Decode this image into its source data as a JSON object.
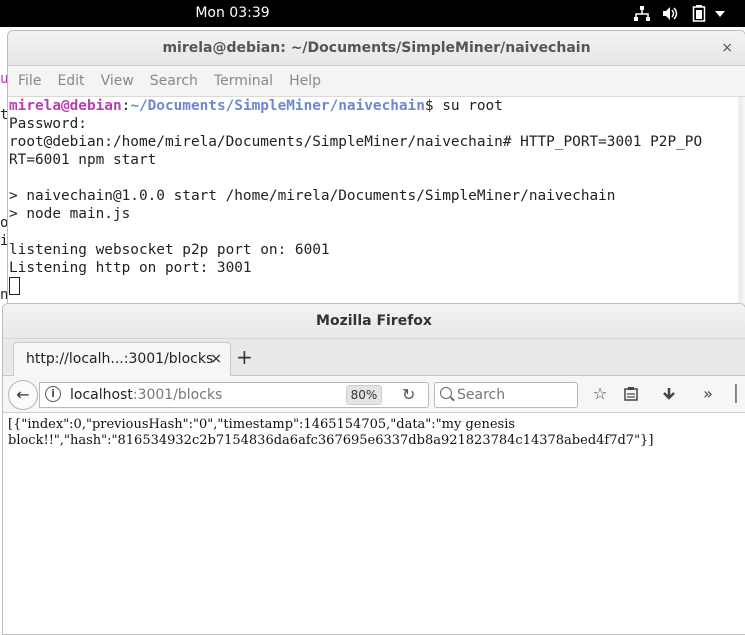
{
  "topbar": {
    "clock": "Mon 03:39"
  },
  "terminal": {
    "title": "mirela@debian: ~/Documents/SimpleMiner/naivechain",
    "close_glyph": "×",
    "menu": [
      "File",
      "Edit",
      "View",
      "Search",
      "Terminal",
      "Help"
    ],
    "prompt_user": "mirela@debian",
    "prompt_sep": ":",
    "prompt_path": "~/Documents/SimpleMiner/naivechain",
    "prompt_cmd": "$ su root",
    "lines": [
      "Password:",
      "root@debian:/home/mirela/Documents/SimpleMiner/naivechain# HTTP_PORT=3001 P2P_PO",
      "RT=6001 npm start",
      "",
      "> naivechain@1.0.0 start /home/mirela/Documents/SimpleMiner/naivechain",
      "> node main.js",
      "",
      "listening websocket p2p port on: 6001",
      "Listening http on port: 3001"
    ]
  },
  "firefox": {
    "title": "Mozilla Firefox",
    "tab_label": "http://localh...:3001/blocks",
    "tab_close": "×",
    "newtab": "+",
    "url_host": "localhost",
    "url_path": ":3001/blocks",
    "zoom": "80%",
    "search_placeholder": "Search",
    "page_text_line1": "[{\"index\":0,\"previousHash\":\"0\",\"timestamp\":1465154705,\"data\":\"my genesis",
    "page_text_line2": "block!!\",\"hash\":\"816534932c2b7154836da6afc367695e6337db8a921823784c14378abed4f7d7\"}]"
  },
  "icons": {
    "back": "back-arrow-icon",
    "info": "info-icon",
    "reload": "reload-icon",
    "bookmark": "star-icon",
    "reader": "clipboard-icon",
    "download": "download-icon",
    "overflow": "chevrons-icon",
    "network": "network-icon",
    "volume": "volume-icon",
    "battery": "battery-icon",
    "menu": "chevron-down-icon"
  },
  "colors": {
    "prompt_user": "#b83fb0",
    "prompt_path": "#6d88d0"
  }
}
